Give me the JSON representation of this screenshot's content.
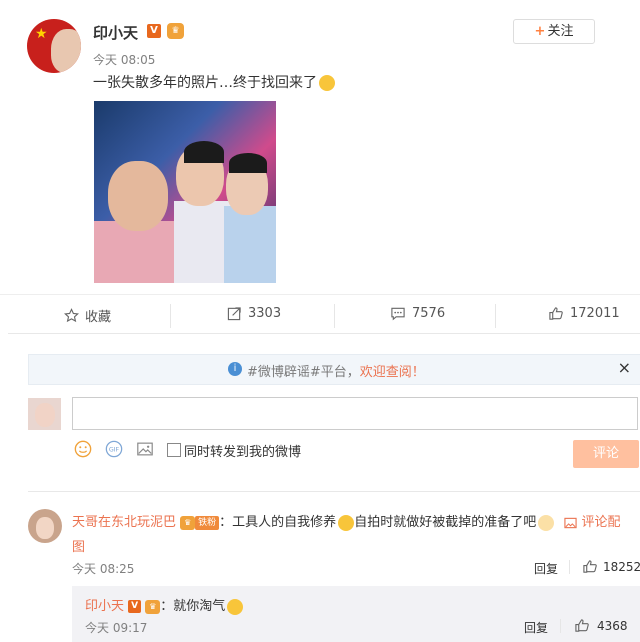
{
  "post": {
    "author": "印小天",
    "verified_badge": "V",
    "time": "今天 08:05",
    "text": "一张失散多年的照片…终于找回来了",
    "follow_label": "关注"
  },
  "actions": {
    "favorite": "收藏",
    "repost_count": "3303",
    "comment_count": "7576",
    "like_count": "172011"
  },
  "notice": {
    "prefix": "#微博辟谣#平台，",
    "highlight": "欢迎查阅！",
    "close": "×"
  },
  "composer": {
    "checkbox_label": "同时转发到我的微博",
    "submit_label": "评论"
  },
  "comment": {
    "author": "天哥在东北玩泥巴",
    "fan_badge": "铁粉",
    "text_a": "：工具人的自我修养",
    "text_b": "自拍时就做好被截掉的准备了吧",
    "attach_label": "评论配",
    "attach_label2": "图",
    "time": "今天 08:25",
    "reply_label": "回复",
    "likes": "18252"
  },
  "subreply": {
    "author": "印小天",
    "text": "：就你淘气",
    "time": "今天 09:17",
    "reply_label": "回复",
    "likes": "4368"
  }
}
